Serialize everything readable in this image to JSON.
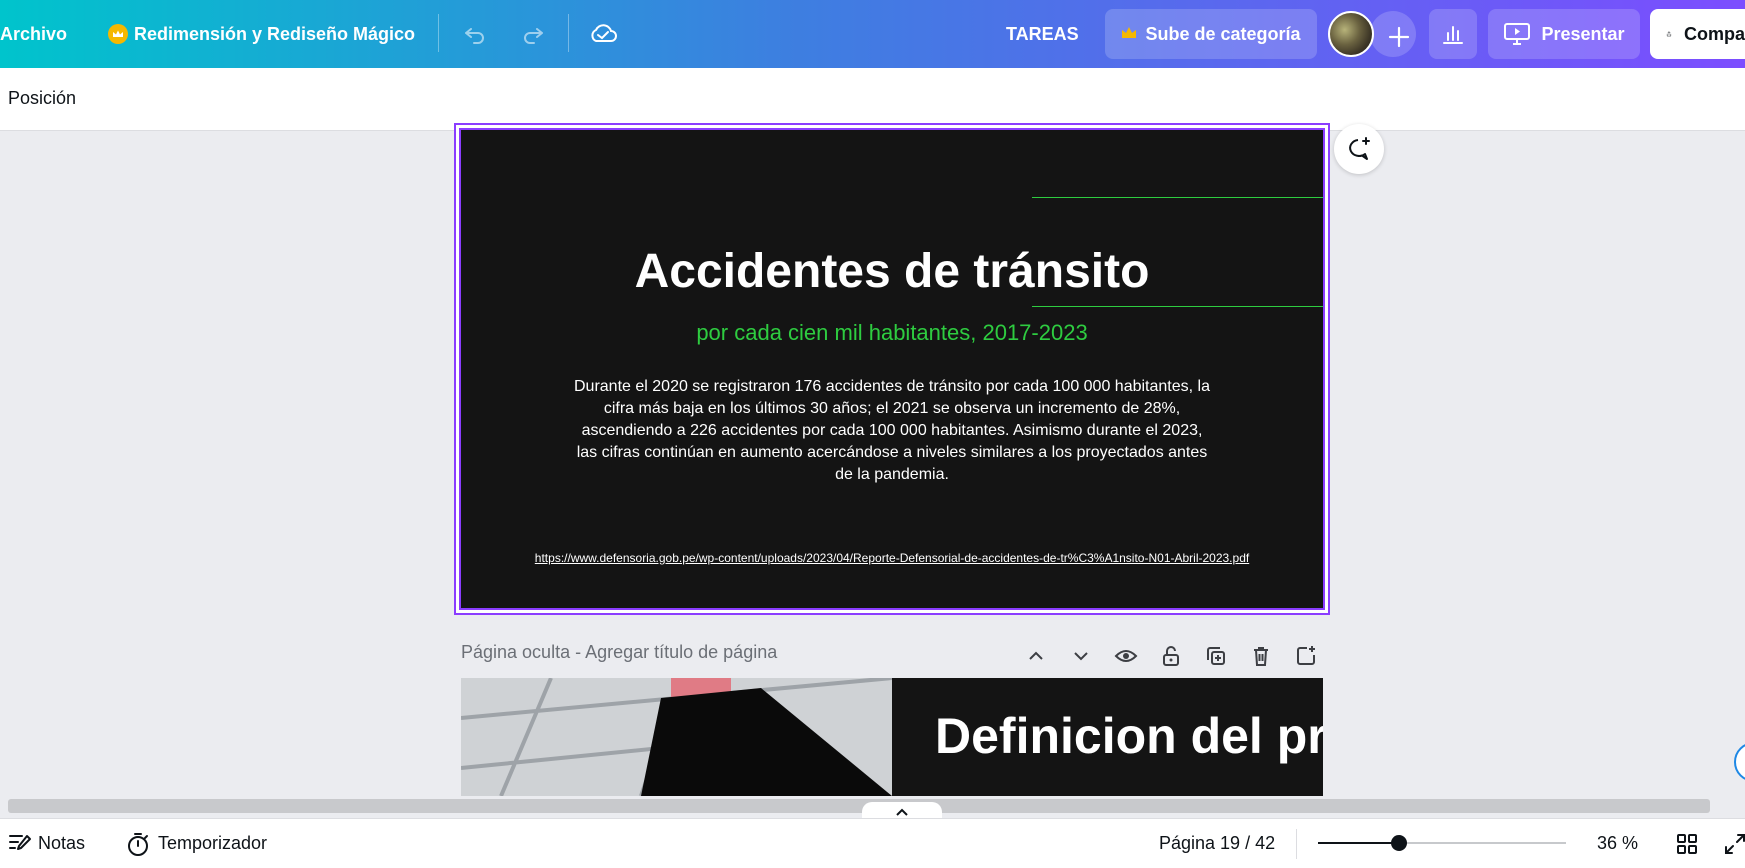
{
  "header": {
    "file_menu": "Archivo",
    "magic_resize": "Redimensión y Rediseño Mágico",
    "tasks": "TAREAS",
    "upgrade": "Sube de categoría",
    "present": "Presentar",
    "share": "Compartir"
  },
  "toolbar": {
    "position": "Posición"
  },
  "slide": {
    "title": "Accidentes de tránsito",
    "subtitle": "por cada cien mil habitantes, 2017-2023",
    "body": "Durante el 2020 se registraron 176 accidentes de tránsito por cada 100 000 habitantes, la cifra más baja en los últimos 30 años; el 2021 se observa un incremento de 28%, ascendiendo a 226 accidentes por cada 100 000 habitantes. Asimismo durante el 2023, las cifras continúan en aumento acercándose a niveles similares a los proyectados antes de la pandemia.",
    "link": "https://www.defensoria.gob.pe/wp-content/uploads/2023/04/Reporte-Defensorial-de-accidentes-de-tr%C3%A1nsito-N01-Abril-2023.pdf"
  },
  "next_page": {
    "header": "Página oculta - Agregar título de página",
    "title": "Definicion del problema"
  },
  "footer": {
    "notes": "Notas",
    "timer": "Temporizador",
    "page_indicator": "Página 19 / 42",
    "zoom": "36 %"
  },
  "zoom_level": 0.36,
  "colors": {
    "accent": "#8b3dff",
    "slide_bg": "#141414",
    "slide_green": "#2ecc40",
    "crown": "#f5b800"
  },
  "icons": [
    "crown-icon",
    "undo-icon",
    "redo-icon",
    "cloud-check-icon",
    "plus-icon",
    "chart-icon",
    "present-icon",
    "share-icon",
    "comment-add-icon",
    "chevron-up-icon",
    "chevron-down-icon",
    "eye-icon",
    "unlock-icon",
    "duplicate-icon",
    "trash-icon",
    "add-page-icon",
    "notes-icon",
    "timer-icon",
    "grid-icon",
    "fullscreen-icon"
  ]
}
